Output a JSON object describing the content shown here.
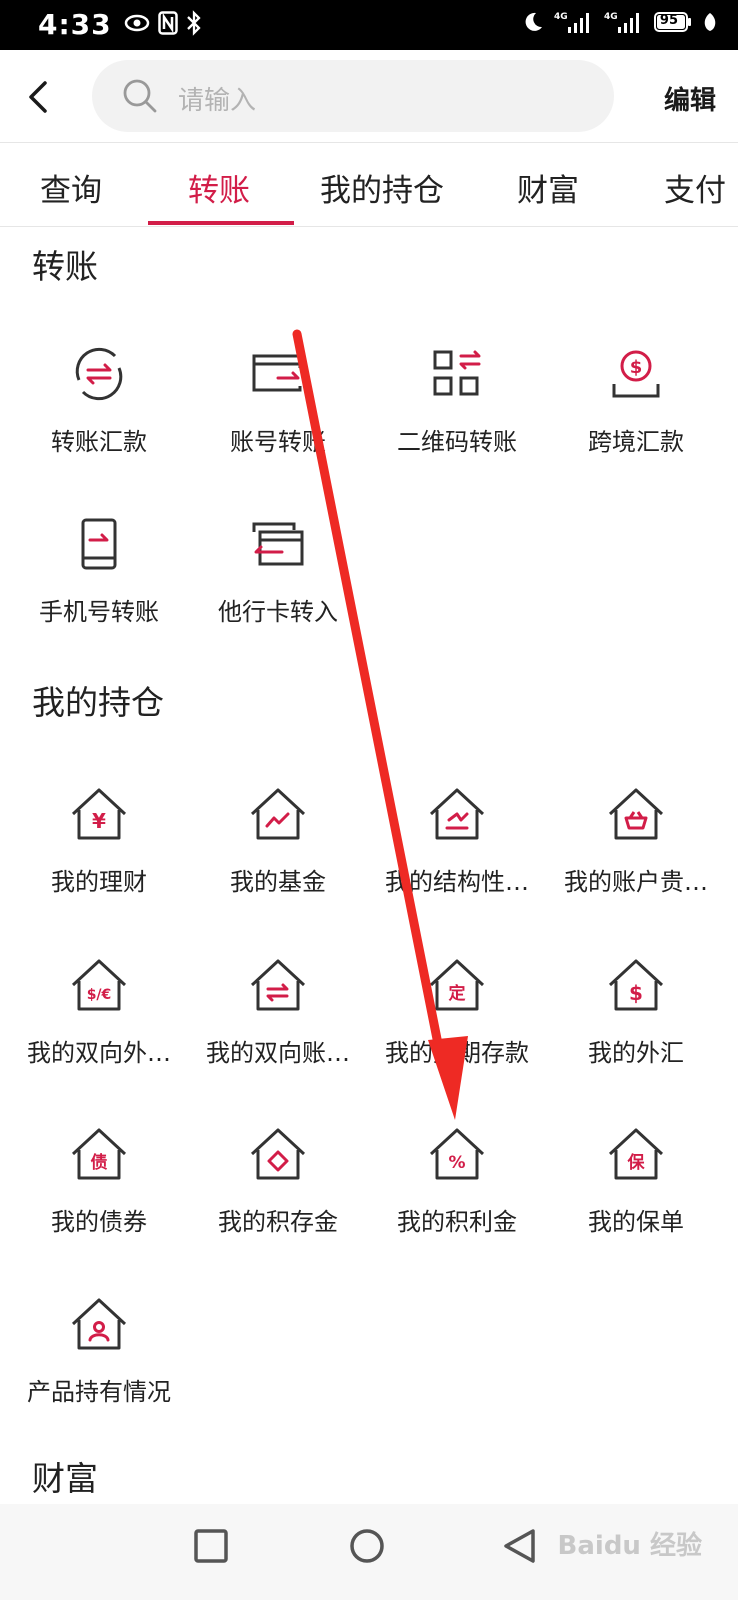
{
  "status_bar": {
    "time": "4:33",
    "battery": "95"
  },
  "header": {
    "search_placeholder": "请输入",
    "edit_label": "编辑"
  },
  "tabs": [
    {
      "label": "查询"
    },
    {
      "label": "转账"
    },
    {
      "label": "我的持仓"
    },
    {
      "label": "财富"
    },
    {
      "label": "支付"
    }
  ],
  "sections": {
    "transfer": {
      "title": "转账",
      "items": [
        {
          "label": "转账汇款",
          "icon": "transfer-circle-icon"
        },
        {
          "label": "账号转账",
          "icon": "card-transfer-icon"
        },
        {
          "label": "二维码转账",
          "icon": "qr-transfer-icon"
        },
        {
          "label": "跨境汇款",
          "icon": "dollar-coin-icon"
        },
        {
          "label": "手机号转账",
          "icon": "phone-transfer-icon"
        },
        {
          "label": "他行卡转入",
          "icon": "cards-transfer-in-icon"
        }
      ]
    },
    "holdings": {
      "title": "我的持仓",
      "items": [
        {
          "label": "我的理财",
          "icon": "house-yen-icon",
          "glyph": "¥"
        },
        {
          "label": "我的基金",
          "icon": "house-chart-icon"
        },
        {
          "label": "我的结构性…",
          "icon": "house-structured-icon"
        },
        {
          "label": "我的账户贵…",
          "icon": "house-basket-icon"
        },
        {
          "label": "我的双向外…",
          "icon": "house-dollar-euro-icon",
          "glyph": "$/€"
        },
        {
          "label": "我的双向账…",
          "icon": "house-exchange-icon"
        },
        {
          "label": "我的定期存款",
          "icon": "house-fixed-deposit-icon",
          "glyph": "定"
        },
        {
          "label": "我的外汇",
          "icon": "house-dollar-icon",
          "glyph": "$"
        },
        {
          "label": "我的债券",
          "icon": "house-bond-icon",
          "glyph": "债"
        },
        {
          "label": "我的积存金",
          "icon": "house-diamond-icon"
        },
        {
          "label": "我的积利金",
          "icon": "house-percent-icon",
          "glyph": "%"
        },
        {
          "label": "我的保单",
          "icon": "house-insurance-icon",
          "glyph": "保"
        },
        {
          "label": "产品持有情况",
          "icon": "house-person-icon"
        }
      ]
    },
    "wealth": {
      "title": "财富"
    }
  },
  "watermark": "Baidu 经验",
  "colors": {
    "accent": "#d21d48",
    "icon_stroke": "#333333",
    "annotation_arrow": "#ee2a24"
  }
}
